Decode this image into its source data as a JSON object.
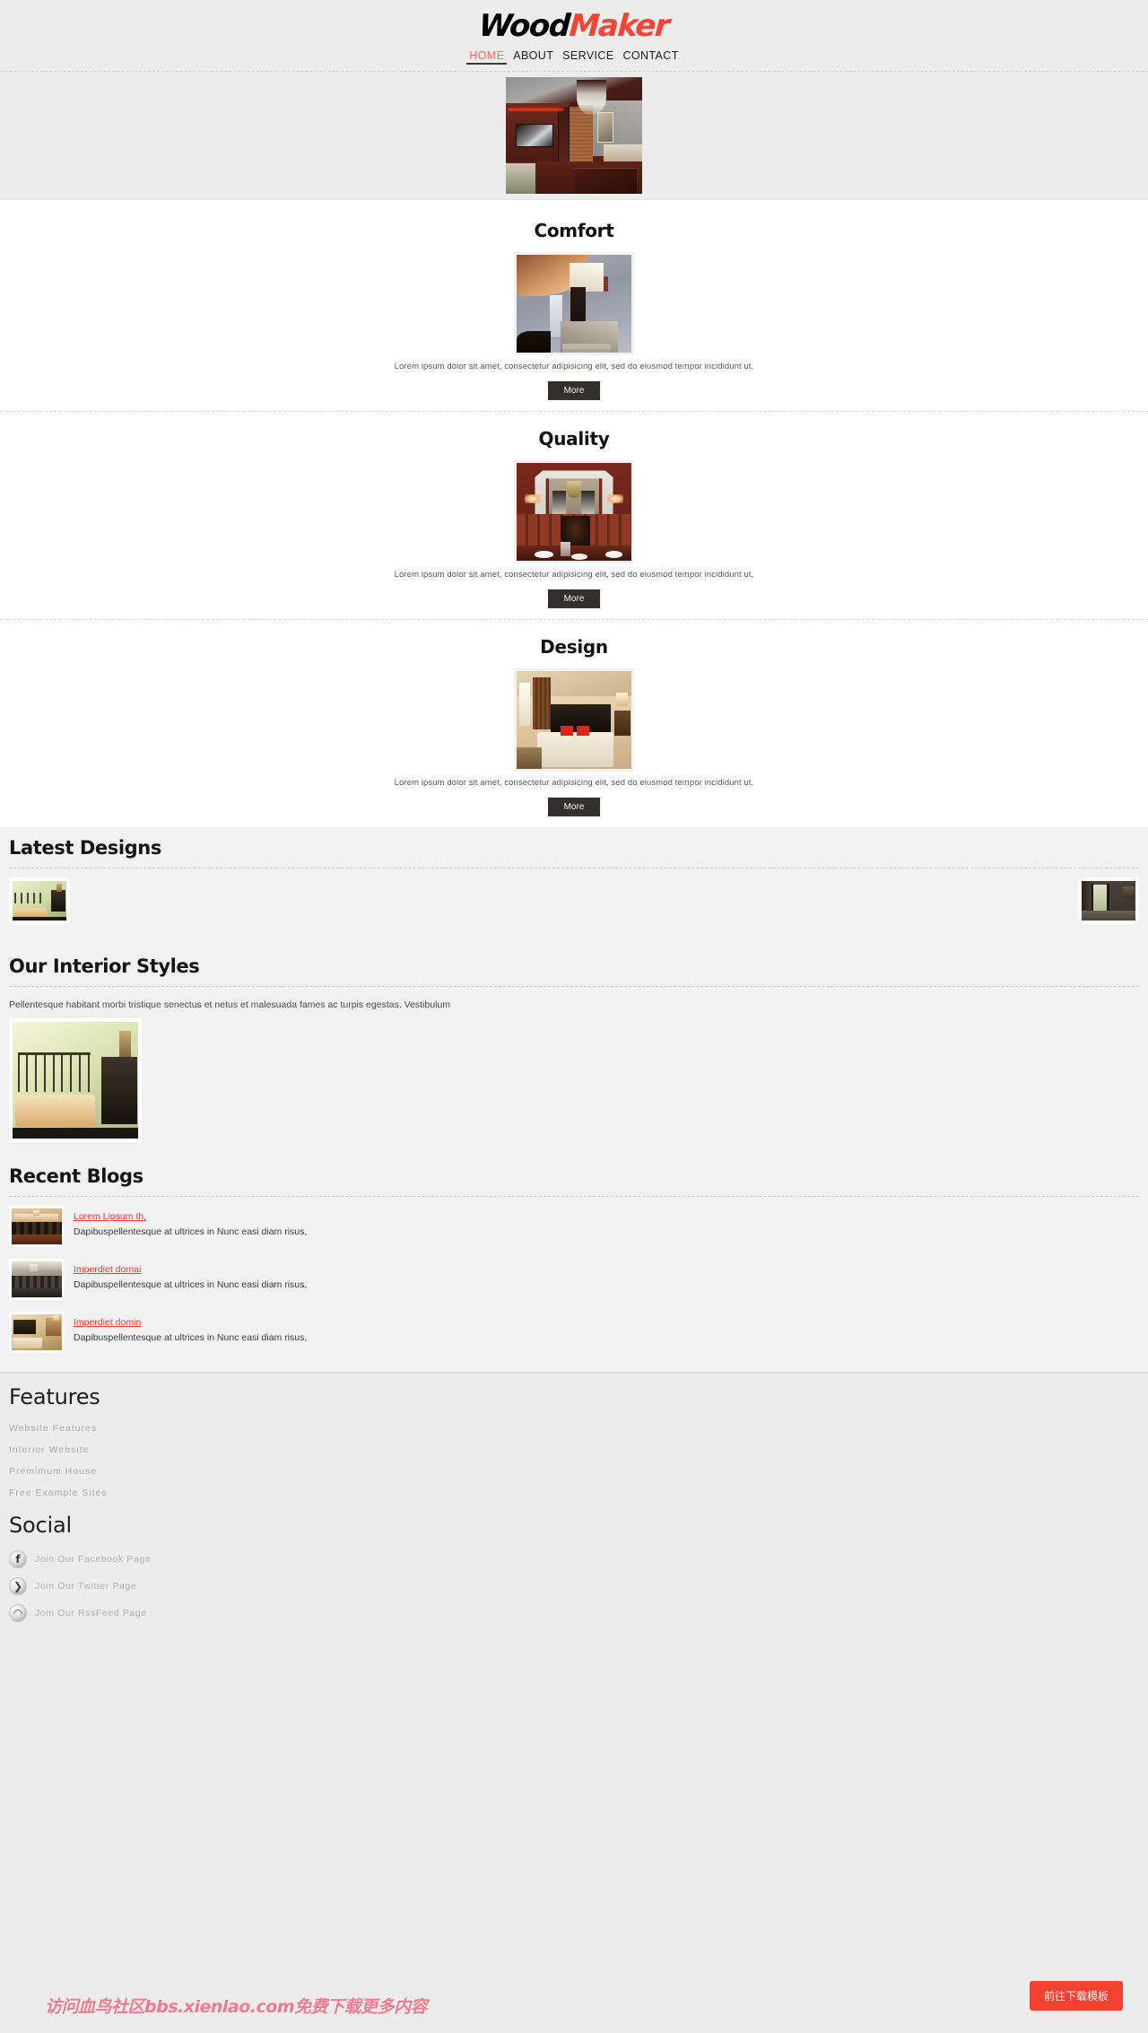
{
  "site": {
    "logo_first": "Wood",
    "logo_second": "Maker",
    "accent_red": "#fc4233",
    "link_red": "#ef3b2c",
    "dark_button": "#332f2d"
  },
  "nav": {
    "items": [
      {
        "label": "HOME",
        "active": true
      },
      {
        "label": "ABOUT",
        "active": false
      },
      {
        "label": "SERVICE",
        "active": false
      },
      {
        "label": "CONTACT",
        "active": false
      }
    ]
  },
  "hero": {
    "image_alt": "modern-living-room-dark-red-interior"
  },
  "features": {
    "blocks": [
      {
        "title": "Comfort",
        "caption": "Lorem ipsum dolor sit amet, consectetur adipisicing elit, sed do eiusmod tempor incididunt ut.",
        "button": "More",
        "image_alt": "curved-staircase-hallway"
      },
      {
        "title": "Quality",
        "caption": "Lorem ipsum dolor sit amet, consectetur adipisicing elit, sed do eiusmod tempor incididunt ut,",
        "button": "More",
        "image_alt": "formal-dining-room-chandelier"
      },
      {
        "title": "Design",
        "caption": "Lorem ipsum dolor sit amet, consectetur adipisicing elit, sed do eiusmod tempor incididunt ut.",
        "button": "More",
        "image_alt": "bedroom-with-red-pillows"
      }
    ]
  },
  "latest_designs": {
    "title": "Latest Designs",
    "thumbs": [
      {
        "alt": "iron-bed-green-room"
      },
      {
        "alt": "dark-room-open-door"
      }
    ]
  },
  "interior_styles": {
    "title": "Our Interior Styles",
    "text": "Pellentesque habitant morbi tristique senectus et netus et malesuada fames ac turpis egestas. Vestibulum",
    "image_alt": "iron-bed-green-room-large"
  },
  "recent_blogs": {
    "title": "Recent Blogs",
    "items": [
      {
        "link": "Lorem Lipsum th,",
        "desc": "Dapibuspellentesque at ultrices in Nunc easi diam risus,",
        "image_alt": "warm-dining-hall"
      },
      {
        "link": "Imperdiet domai",
        "desc": "Dapibuspellentesque at ultrices in Nunc easi diam risus,",
        "image_alt": "long-dining-table-dark"
      },
      {
        "link": "Imperdiet domin",
        "desc": "Dapibuspellentesque at ultrices in Nunc easi diam risus,",
        "image_alt": "warm-bedroom"
      }
    ]
  },
  "footer": {
    "features_title": "Features",
    "features_links": [
      "Website Features",
      "Interior Website",
      "Premimum House",
      "Free Example Sites"
    ],
    "social_title": "Social",
    "social_links": [
      {
        "icon": "facebook-icon",
        "glyph": "f",
        "label": "Join Our Facebook Page"
      },
      {
        "icon": "twitter-icon",
        "glyph": "❯",
        "label": "Join Our Twitter Page"
      },
      {
        "icon": "rss-icon",
        "glyph": "◠",
        "label": "Join Our RssFeed Page"
      }
    ]
  },
  "overlay": {
    "watermark": "访问血鸟社区bbs.xienlao.com免费下载更多内容",
    "download_button": "前往下载模板"
  }
}
